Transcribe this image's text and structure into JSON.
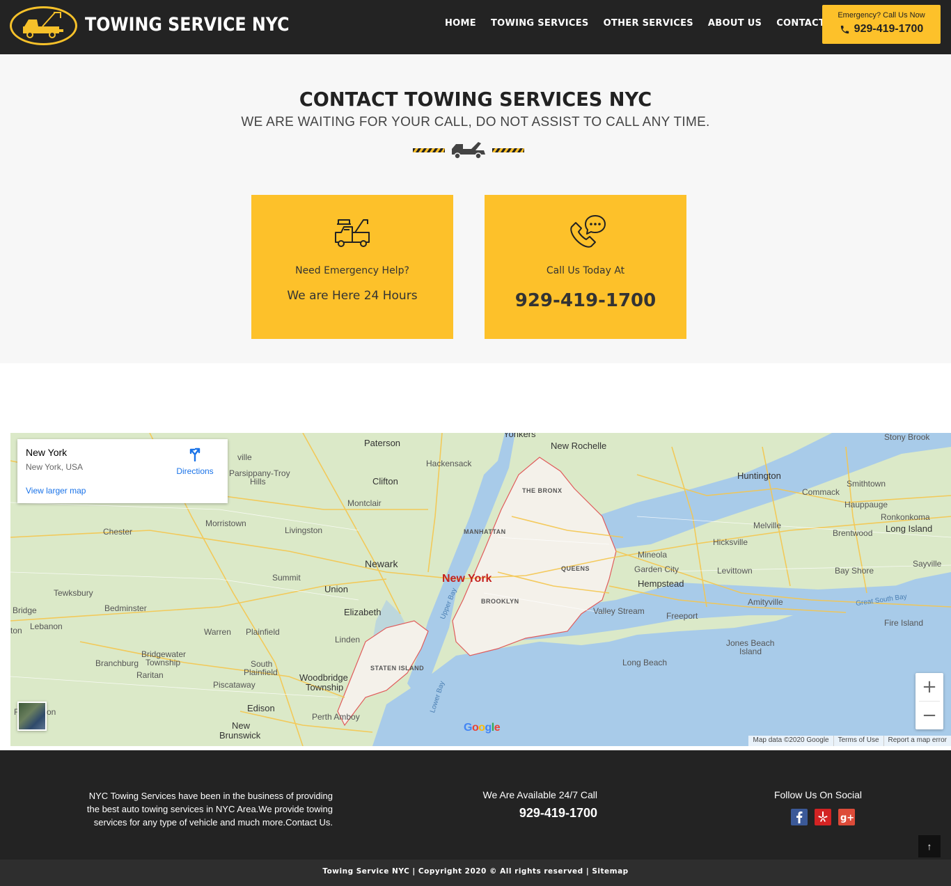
{
  "header": {
    "logo_text": "TOWING SERVICE NYC",
    "nav": [
      "HOME",
      "TOWING SERVICES",
      "OTHER SERVICES",
      "ABOUT US",
      "CONTACT US"
    ],
    "emergency_label": "Emergency? Call Us Now",
    "emergency_phone": "929-419-1700"
  },
  "contact": {
    "title": "CONTACT TOWING SERVICES NYC",
    "subtitle": "WE ARE WAITING FOR YOUR CALL, DO NOT ASSIST TO CALL ANY TIME.",
    "cards": [
      {
        "label": "Need Emergency Help?",
        "value": "We are Here 24 Hours",
        "icon": "tow-truck-icon"
      },
      {
        "label": "Call Us Today At",
        "value": "929-419-1700",
        "icon": "phone-chat-icon"
      }
    ]
  },
  "map": {
    "place_title": "New York",
    "place_subtitle": "New York, USA",
    "directions_label": "Directions",
    "larger_map_label": "View larger map",
    "zoom_in": "+",
    "zoom_out": "−",
    "footer": [
      "Map data ©2020 Google",
      "Terms of Use",
      "Report a map error"
    ],
    "google_logo": "Google",
    "labels": {
      "yonkers": "Yonkers",
      "new_rochelle": "New Rochelle",
      "paterson": "Paterson",
      "hackensack": "Hackensack",
      "clifton": "Clifton",
      "montclair": "Montclair",
      "parsippany": "Parsippany-Troy",
      "hills": "Hills",
      "morristown": "Morristown",
      "chester": "Chester",
      "livingston": "Livingston",
      "newark": "Newark",
      "summit": "Summit",
      "union": "Union",
      "elizabeth": "Elizabeth",
      "tewksbury": "Tewksbury",
      "bedminster": "Bedminster",
      "bridge": "Bridge",
      "lebanon": "Lebanon",
      "ton": "ton",
      "warren": "Warren",
      "plainfield": "Plainfield",
      "linden": "Linden",
      "bridgewater": "Bridgewater",
      "township": "Township",
      "branchburg": "Branchburg",
      "raritan": "Raritan",
      "south_plainfield": "South",
      "south_plainfield2": "Plainfield",
      "piscataway": "Piscataway",
      "woodbridge": "Woodbridge",
      "woodbridge2": "Township",
      "edison": "Edison",
      "perth_amboy": "Perth Amboy",
      "new_brunswick": "New",
      "new_brunswick2": "Brunswick",
      "ville": "ville",
      "the_bronx": "THE BRONX",
      "manhattan": "MANHATTAN",
      "queens": "QUEENS",
      "brooklyn": "BROOKLYN",
      "staten_island": "STATEN ISLAND",
      "new_york": "New York",
      "upper_bay": "Upper Bay",
      "lower_bay": "Lower Bay",
      "mineola": "Mineola",
      "garden_city": "Garden City",
      "hempstead": "Hempstead",
      "valley_stream": "Valley Stream",
      "freeport": "Freeport",
      "long_beach": "Long Beach",
      "jones_beach": "Jones Beach",
      "jones_beach2": "Island",
      "hicksville": "Hicksville",
      "levittown": "Levittown",
      "amityville": "Amityville",
      "huntington": "Huntington",
      "commack": "Commack",
      "melville": "Melville",
      "smithtown": "Smithtown",
      "hauppauge": "Hauppauge",
      "ronkonkoma": "Ronkonkoma",
      "long_island": "Long Island",
      "brentwood": "Brentwood",
      "bay_shore": "Bay Shore",
      "sayville": "Sayville",
      "stony_brook": "Stony Brook",
      "great_south_bay": "Great South Bay",
      "fire_island": "Fire Island",
      "edison_left": "F",
      "edison_left2": "on"
    }
  },
  "footer": {
    "about": "NYC Towing Services have been in the business of providing the best auto towing services in NYC Area.We provide towing services for any type of vehicle and much more.Contact Us.",
    "available": "We Are Available 24/7 Call",
    "phone": "929-419-1700",
    "social_title": "Follow Us On Social",
    "social": [
      "facebook-icon",
      "yelp-icon",
      "google-plus-icon"
    ],
    "back_to_top": "↑",
    "copyright": "Towing Service NYC | Copyright 2020 © All rights reserved | ",
    "sitemap": "Sitemap"
  },
  "colors": {
    "accent": "#fdc12a",
    "dark": "#232323",
    "bottom_bar": "#2e2e2e",
    "link_blue": "#1a73e8",
    "map_land": "#dbe9c8",
    "map_water": "#a8cbe9",
    "nyc_border": "#e05b5b"
  }
}
